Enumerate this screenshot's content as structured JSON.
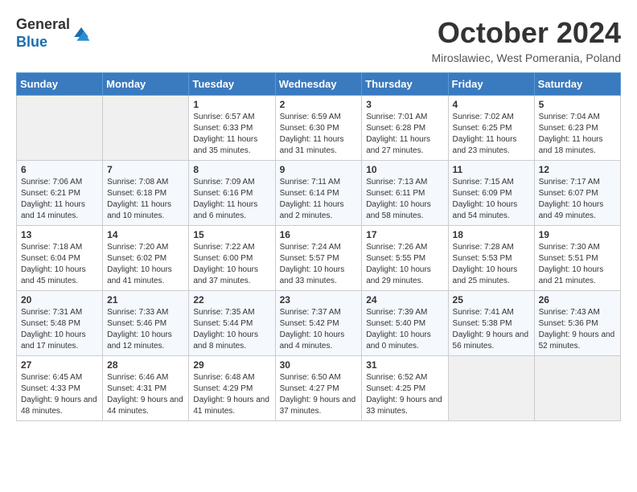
{
  "header": {
    "logo_general": "General",
    "logo_blue": "Blue",
    "month_title": "October 2024",
    "location": "Miroslawiec, West Pomerania, Poland"
  },
  "weekdays": [
    "Sunday",
    "Monday",
    "Tuesday",
    "Wednesday",
    "Thursday",
    "Friday",
    "Saturday"
  ],
  "weeks": [
    [
      {
        "day": "",
        "info": ""
      },
      {
        "day": "",
        "info": ""
      },
      {
        "day": "1",
        "info": "Sunrise: 6:57 AM\nSunset: 6:33 PM\nDaylight: 11 hours and 35 minutes."
      },
      {
        "day": "2",
        "info": "Sunrise: 6:59 AM\nSunset: 6:30 PM\nDaylight: 11 hours and 31 minutes."
      },
      {
        "day": "3",
        "info": "Sunrise: 7:01 AM\nSunset: 6:28 PM\nDaylight: 11 hours and 27 minutes."
      },
      {
        "day": "4",
        "info": "Sunrise: 7:02 AM\nSunset: 6:25 PM\nDaylight: 11 hours and 23 minutes."
      },
      {
        "day": "5",
        "info": "Sunrise: 7:04 AM\nSunset: 6:23 PM\nDaylight: 11 hours and 18 minutes."
      }
    ],
    [
      {
        "day": "6",
        "info": "Sunrise: 7:06 AM\nSunset: 6:21 PM\nDaylight: 11 hours and 14 minutes."
      },
      {
        "day": "7",
        "info": "Sunrise: 7:08 AM\nSunset: 6:18 PM\nDaylight: 11 hours and 10 minutes."
      },
      {
        "day": "8",
        "info": "Sunrise: 7:09 AM\nSunset: 6:16 PM\nDaylight: 11 hours and 6 minutes."
      },
      {
        "day": "9",
        "info": "Sunrise: 7:11 AM\nSunset: 6:14 PM\nDaylight: 11 hours and 2 minutes."
      },
      {
        "day": "10",
        "info": "Sunrise: 7:13 AM\nSunset: 6:11 PM\nDaylight: 10 hours and 58 minutes."
      },
      {
        "day": "11",
        "info": "Sunrise: 7:15 AM\nSunset: 6:09 PM\nDaylight: 10 hours and 54 minutes."
      },
      {
        "day": "12",
        "info": "Sunrise: 7:17 AM\nSunset: 6:07 PM\nDaylight: 10 hours and 49 minutes."
      }
    ],
    [
      {
        "day": "13",
        "info": "Sunrise: 7:18 AM\nSunset: 6:04 PM\nDaylight: 10 hours and 45 minutes."
      },
      {
        "day": "14",
        "info": "Sunrise: 7:20 AM\nSunset: 6:02 PM\nDaylight: 10 hours and 41 minutes."
      },
      {
        "day": "15",
        "info": "Sunrise: 7:22 AM\nSunset: 6:00 PM\nDaylight: 10 hours and 37 minutes."
      },
      {
        "day": "16",
        "info": "Sunrise: 7:24 AM\nSunset: 5:57 PM\nDaylight: 10 hours and 33 minutes."
      },
      {
        "day": "17",
        "info": "Sunrise: 7:26 AM\nSunset: 5:55 PM\nDaylight: 10 hours and 29 minutes."
      },
      {
        "day": "18",
        "info": "Sunrise: 7:28 AM\nSunset: 5:53 PM\nDaylight: 10 hours and 25 minutes."
      },
      {
        "day": "19",
        "info": "Sunrise: 7:30 AM\nSunset: 5:51 PM\nDaylight: 10 hours and 21 minutes."
      }
    ],
    [
      {
        "day": "20",
        "info": "Sunrise: 7:31 AM\nSunset: 5:48 PM\nDaylight: 10 hours and 17 minutes."
      },
      {
        "day": "21",
        "info": "Sunrise: 7:33 AM\nSunset: 5:46 PM\nDaylight: 10 hours and 12 minutes."
      },
      {
        "day": "22",
        "info": "Sunrise: 7:35 AM\nSunset: 5:44 PM\nDaylight: 10 hours and 8 minutes."
      },
      {
        "day": "23",
        "info": "Sunrise: 7:37 AM\nSunset: 5:42 PM\nDaylight: 10 hours and 4 minutes."
      },
      {
        "day": "24",
        "info": "Sunrise: 7:39 AM\nSunset: 5:40 PM\nDaylight: 10 hours and 0 minutes."
      },
      {
        "day": "25",
        "info": "Sunrise: 7:41 AM\nSunset: 5:38 PM\nDaylight: 9 hours and 56 minutes."
      },
      {
        "day": "26",
        "info": "Sunrise: 7:43 AM\nSunset: 5:36 PM\nDaylight: 9 hours and 52 minutes."
      }
    ],
    [
      {
        "day": "27",
        "info": "Sunrise: 6:45 AM\nSunset: 4:33 PM\nDaylight: 9 hours and 48 minutes."
      },
      {
        "day": "28",
        "info": "Sunrise: 6:46 AM\nSunset: 4:31 PM\nDaylight: 9 hours and 44 minutes."
      },
      {
        "day": "29",
        "info": "Sunrise: 6:48 AM\nSunset: 4:29 PM\nDaylight: 9 hours and 41 minutes."
      },
      {
        "day": "30",
        "info": "Sunrise: 6:50 AM\nSunset: 4:27 PM\nDaylight: 9 hours and 37 minutes."
      },
      {
        "day": "31",
        "info": "Sunrise: 6:52 AM\nSunset: 4:25 PM\nDaylight: 9 hours and 33 minutes."
      },
      {
        "day": "",
        "info": ""
      },
      {
        "day": "",
        "info": ""
      }
    ]
  ]
}
